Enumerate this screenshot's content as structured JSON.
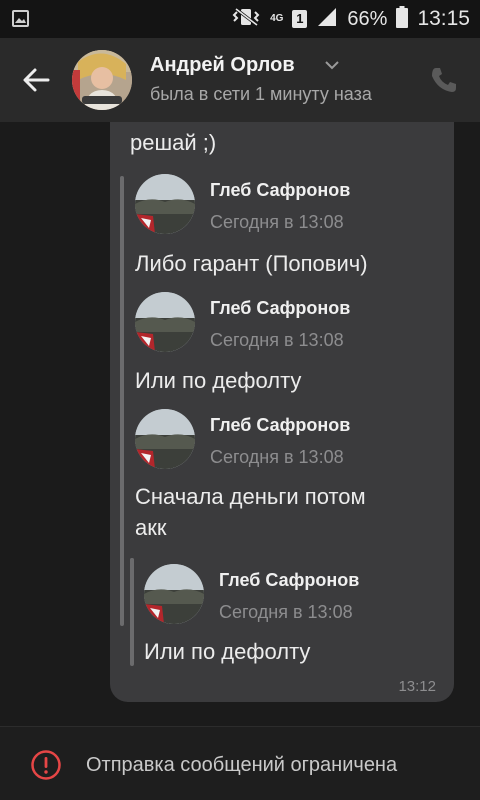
{
  "status_bar": {
    "network_label": "4G",
    "sim_label": "1",
    "battery_text": "66%",
    "time": "13:15",
    "icons": [
      "gallery-icon",
      "vibrate-icon",
      "signal-icon",
      "battery-icon"
    ]
  },
  "header": {
    "contact_name": "Андрей Орлов",
    "contact_status": "была в сети 1 минуту наза",
    "icons": [
      "back-arrow-icon",
      "chevron-down-icon",
      "phone-icon"
    ]
  },
  "message": {
    "partial_text": "решай ;)",
    "time": "13:12",
    "forwarded": [
      {
        "author": "Глеб Сафронов",
        "time": "Сегодня в 13:08",
        "text": "Либо гарант (Попович)"
      },
      {
        "author": "Глеб Сафронов",
        "time": "Сегодня в 13:08",
        "text": "Или по дефолту"
      },
      {
        "author": "Глеб Сафронов",
        "time": "Сегодня в 13:08",
        "text_lines": [
          "Сначала деньги потом",
          "акк"
        ]
      }
    ],
    "nested_forwarded": {
      "author": "Глеб Сафронов",
      "time": "Сегодня в 13:08",
      "text": "Или по дефолту"
    }
  },
  "footer": {
    "text": "Отправка сообщений ограничена",
    "icon": "alert-circle-icon"
  },
  "colors": {
    "background": "#1b1b1b",
    "header": "#2a2a2a",
    "bubble": "#3b3b3d",
    "alert": "#e64646"
  }
}
